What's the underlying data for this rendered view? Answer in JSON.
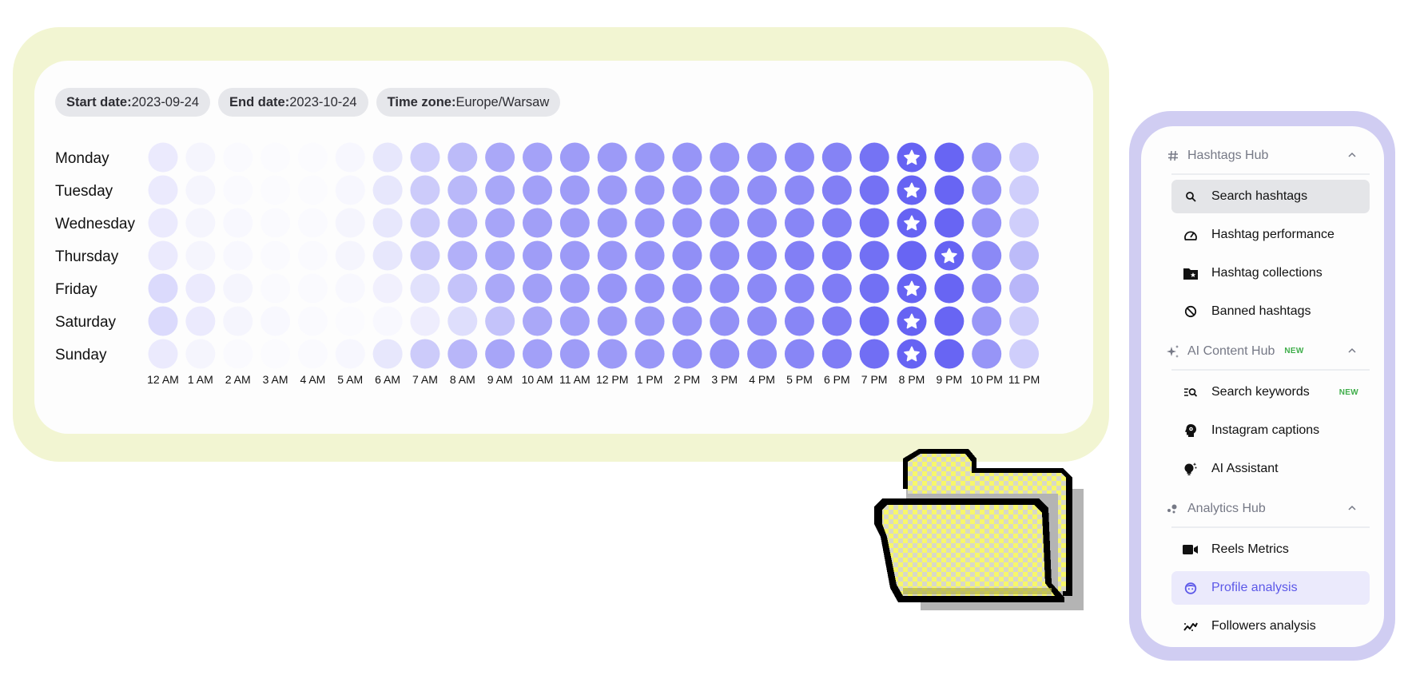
{
  "filters": {
    "start_date": {
      "label": "Start date:",
      "value": "2023-09-24"
    },
    "end_date": {
      "label": "End date:",
      "value": "2023-10-24"
    },
    "time_zone": {
      "label": "Time zone:",
      "value": "Europe/Warsaw"
    }
  },
  "chart_data": {
    "type": "heatmap",
    "title": "",
    "xlabel": "",
    "ylabel": "",
    "value_range": [
      0,
      100
    ],
    "color_min": "#fdfdfe",
    "color_max": "#6360f3",
    "highlight_marker": "star",
    "rows": [
      "Monday",
      "Tuesday",
      "Wednesday",
      "Thursday",
      "Friday",
      "Saturday",
      "Sunday"
    ],
    "columns": [
      "12 AM",
      "1 AM",
      "2 AM",
      "3 AM",
      "4 AM",
      "5 AM",
      "6 AM",
      "7 AM",
      "8 AM",
      "9 AM",
      "10 AM",
      "11 AM",
      "12 PM",
      "1 PM",
      "2 PM",
      "3 PM",
      "4 PM",
      "5 PM",
      "6 PM",
      "7 PM",
      "8 PM",
      "9 PM",
      "10 PM",
      "11 PM"
    ],
    "values": [
      [
        12,
        5,
        2,
        1,
        1,
        4,
        14,
        30,
        42,
        54,
        58,
        62,
        63,
        64,
        66,
        67,
        70,
        74,
        78,
        88,
        98,
        97,
        67,
        30
      ],
      [
        12,
        5,
        2,
        1,
        1,
        4,
        14,
        32,
        44,
        55,
        59,
        62,
        63,
        65,
        67,
        69,
        71,
        74,
        80,
        89,
        98,
        97,
        66,
        30
      ],
      [
        12,
        5,
        3,
        2,
        2,
        5,
        14,
        33,
        47,
        56,
        60,
        62,
        64,
        66,
        68,
        70,
        72,
        76,
        81,
        89,
        98,
        97,
        67,
        30
      ],
      [
        12,
        5,
        3,
        2,
        2,
        5,
        14,
        34,
        49,
        57,
        61,
        63,
        65,
        67,
        70,
        72,
        76,
        80,
        84,
        90,
        97,
        98,
        74,
        42
      ],
      [
        22,
        12,
        5,
        2,
        2,
        3,
        8,
        18,
        37,
        54,
        60,
        63,
        66,
        68,
        71,
        72,
        74,
        77,
        82,
        90,
        98,
        97,
        75,
        45
      ],
      [
        22,
        12,
        5,
        3,
        2,
        1,
        3,
        10,
        20,
        37,
        54,
        59,
        63,
        64,
        67,
        69,
        72,
        76,
        82,
        92,
        98,
        97,
        65,
        30
      ],
      [
        12,
        5,
        2,
        1,
        2,
        4,
        14,
        32,
        45,
        56,
        59,
        62,
        63,
        65,
        68,
        70,
        72,
        76,
        82,
        91,
        98,
        97,
        66,
        30
      ]
    ],
    "highlights": [
      {
        "row": "Monday",
        "column": "8 PM"
      },
      {
        "row": "Tuesday",
        "column": "8 PM"
      },
      {
        "row": "Wednesday",
        "column": "8 PM"
      },
      {
        "row": "Thursday",
        "column": "9 PM"
      },
      {
        "row": "Friday",
        "column": "8 PM"
      },
      {
        "row": "Saturday",
        "column": "8 PM"
      },
      {
        "row": "Sunday",
        "column": "8 PM"
      }
    ]
  },
  "sidebar": {
    "accent": "#5c58e8",
    "new_badge_color": "#3fae4a",
    "groups": [
      {
        "label": "Hashtags Hub",
        "icon": "hash-icon",
        "badge": "",
        "expanded": true,
        "items": [
          {
            "label": "Search hashtags",
            "icon": "search-icon",
            "badge": "",
            "state": "hover"
          },
          {
            "label": "Hashtag performance",
            "icon": "speedometer-icon",
            "badge": "",
            "state": ""
          },
          {
            "label": "Hashtag collections",
            "icon": "folder-star-icon",
            "badge": "",
            "state": ""
          },
          {
            "label": "Banned hashtags",
            "icon": "ban-icon",
            "badge": "",
            "state": ""
          }
        ]
      },
      {
        "label": "AI Content Hub",
        "icon": "sparkles-icon",
        "badge": "NEW",
        "expanded": true,
        "items": [
          {
            "label": "Search keywords",
            "icon": "keyword-search-icon",
            "badge": "NEW",
            "state": ""
          },
          {
            "label": "Instagram captions",
            "icon": "head-gear-icon",
            "badge": "",
            "state": ""
          },
          {
            "label": "AI Assistant",
            "icon": "lightbulb-sparkle-icon",
            "badge": "",
            "state": ""
          }
        ]
      },
      {
        "label": "Analytics Hub",
        "icon": "dots-icon",
        "badge": "",
        "expanded": true,
        "items": [
          {
            "label": "Reels Metrics",
            "icon": "video-camera-icon",
            "badge": "",
            "state": ""
          },
          {
            "label": "Profile analysis",
            "icon": "face-icon",
            "badge": "",
            "state": "active"
          },
          {
            "label": "Followers analysis",
            "icon": "trend-line-icon",
            "badge": "",
            "state": ""
          }
        ]
      }
    ]
  },
  "decoration": {
    "folder_icon": "open-folder-icon"
  }
}
